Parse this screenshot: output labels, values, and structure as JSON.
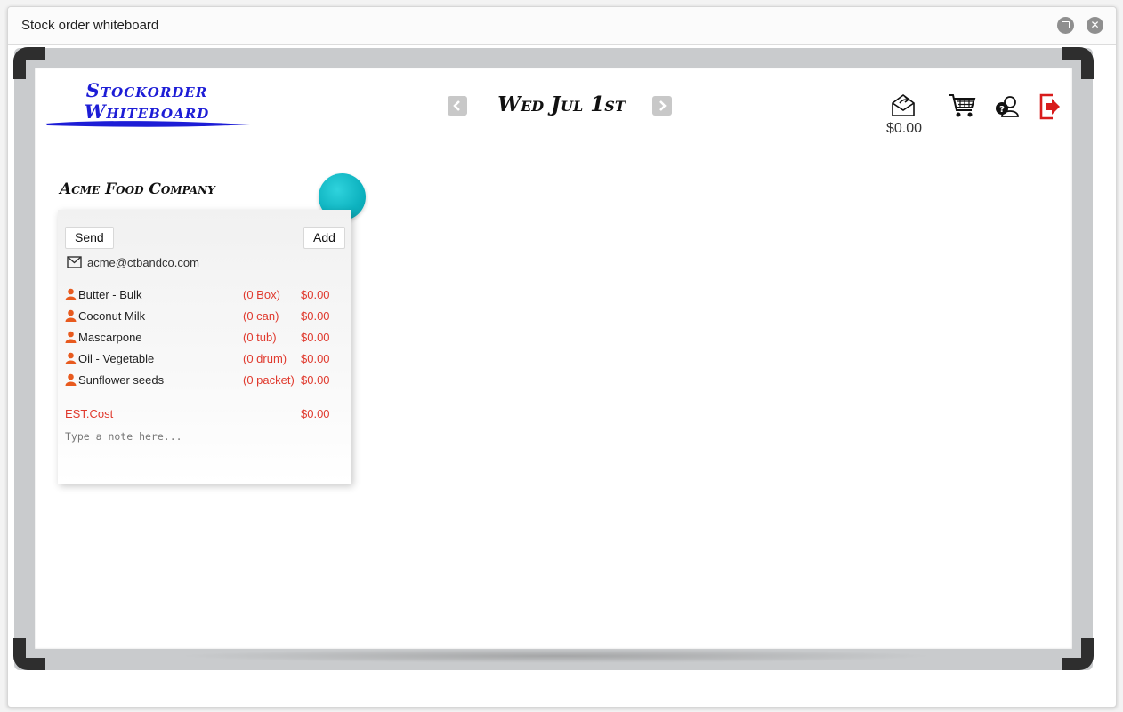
{
  "window": {
    "title": "Stock order whiteboard"
  },
  "logo": {
    "line1": "Stockorder",
    "line2": "Whiteboard"
  },
  "date_nav": {
    "date": "Wed Jul 1st",
    "prev_icon": "chevron-left-icon",
    "next_icon": "chevron-right-icon"
  },
  "header_icons": {
    "mail_total": "$0.00",
    "icons": [
      "envelope-send-icon",
      "cart-icon",
      "help-user-icon",
      "logout-icon"
    ],
    "logout_color": "#d81c1c"
  },
  "supplier": {
    "name": "Acme Food Company",
    "send_label": "Send",
    "add_label": "Add",
    "email": "acme@ctbandco.com",
    "items": [
      {
        "name": "Butter - Bulk",
        "qty": "(0 Box)",
        "price": "$0.00"
      },
      {
        "name": "Coconut Milk",
        "qty": "(0 can)",
        "price": "$0.00"
      },
      {
        "name": "Mascarpone",
        "qty": "(0 tub)",
        "price": "$0.00"
      },
      {
        "name": "Oil - Vegetable",
        "qty": "(0 drum)",
        "price": "$0.00"
      },
      {
        "name": "Sunflower seeds",
        "qty": "(0 packet)",
        "price": "$0.00"
      }
    ],
    "est_label": "EST.Cost",
    "est_value": "$0.00",
    "note_placeholder": "Type a note here...",
    "accent_color": "#0db2bf",
    "price_color": "#e03a2e"
  }
}
